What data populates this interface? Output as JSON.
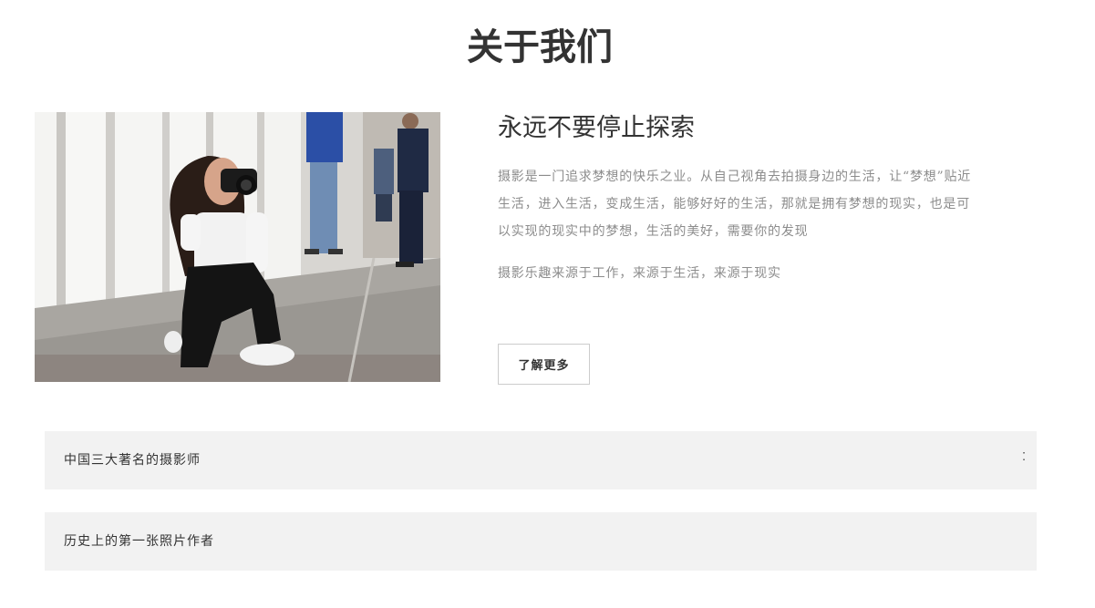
{
  "page": {
    "title": "关于我们"
  },
  "about": {
    "photo": {
      "subject": "photographer-kneeling-with-camera"
    },
    "heading": "永远不要停止探索",
    "paragraph_1": "摄影是一门追求梦想的快乐之业。从自己视角去拍摄身边的生活，让“梦想”贴近生活，进入生活，变成生活，能够好好的生活，那就是拥有梦想的现实，也是可以实现的现实中的梦想，生活的美好，需要你的发现",
    "paragraph_2": "摄影乐趣来源于工作，来源于生活，来源于现实",
    "button_label": "了解更多"
  },
  "accordion": {
    "items": [
      {
        "label": "中国三大著名的摄影师",
        "toggle_icon": "⁚"
      },
      {
        "label": "历史上的第一张照片作者"
      }
    ]
  },
  "colors": {
    "title_text": "#333333",
    "body_text": "#8c8c8c",
    "panel_background": "#f2f2f2",
    "button_border": "#cccccc"
  }
}
